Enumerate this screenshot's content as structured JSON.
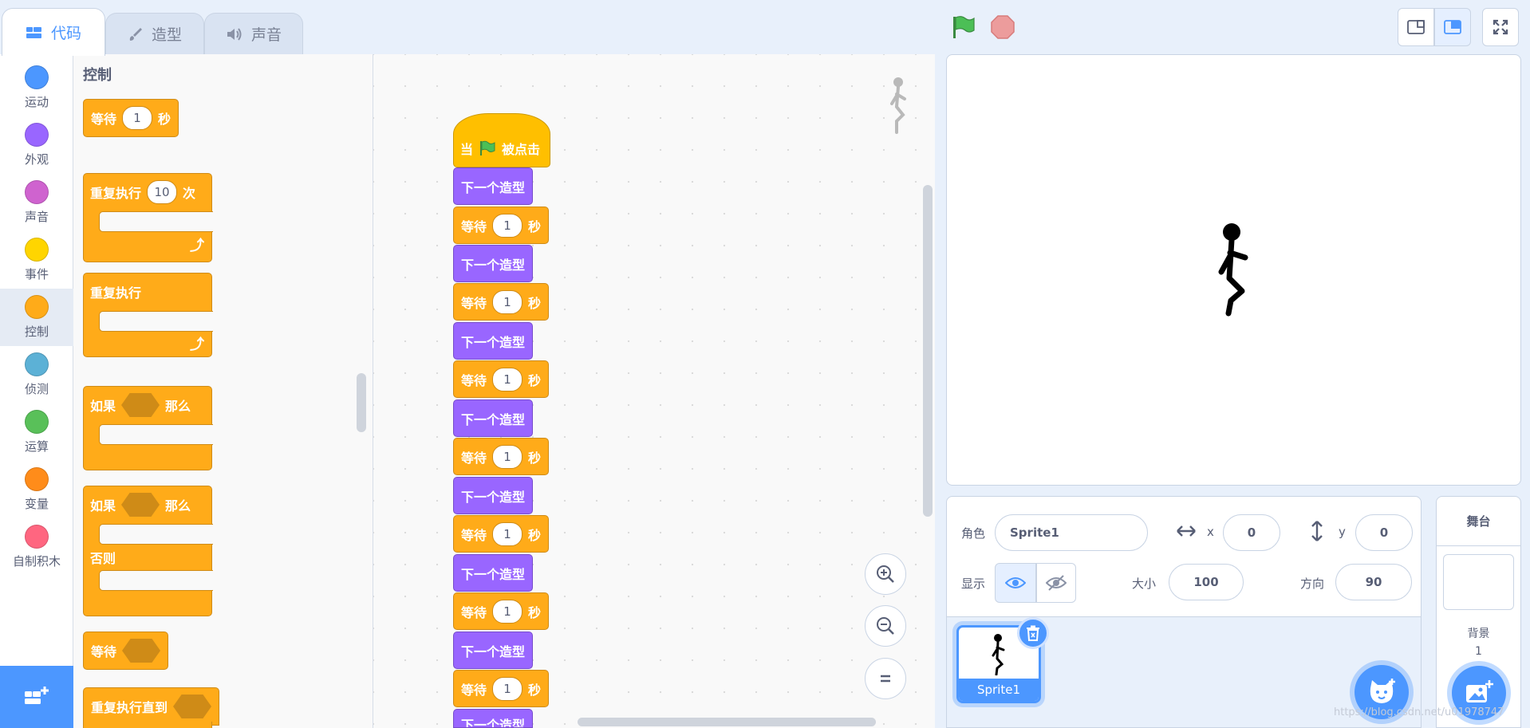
{
  "tabs": [
    {
      "label": "代码",
      "icon": "code-icon",
      "active": true
    },
    {
      "label": "造型",
      "icon": "brush-icon",
      "active": false
    },
    {
      "label": "声音",
      "icon": "speaker-icon",
      "active": false
    }
  ],
  "categories": [
    {
      "label": "运动",
      "color": "#4c97ff"
    },
    {
      "label": "外观",
      "color": "#9966ff"
    },
    {
      "label": "声音",
      "color": "#cf63cf"
    },
    {
      "label": "事件",
      "color": "#ffd500"
    },
    {
      "label": "控制",
      "color": "#ffab19",
      "selected": true
    },
    {
      "label": "侦测",
      "color": "#5cb1d6"
    },
    {
      "label": "运算",
      "color": "#59c059"
    },
    {
      "label": "变量",
      "color": "#ff8c1a"
    },
    {
      "label": "自制积木",
      "color": "#ff6680"
    }
  ],
  "palette": {
    "title": "控制",
    "wait": {
      "text": "等待",
      "value": "1",
      "unit": "秒"
    },
    "repeat": {
      "text": "重复执行",
      "value": "10",
      "unit": "次"
    },
    "forever": {
      "text": "重复执行"
    },
    "if_then": {
      "if": "如果",
      "then": "那么"
    },
    "if_else": {
      "if": "如果",
      "then": "那么",
      "else": "否则"
    },
    "wait_until": {
      "text": "等待"
    },
    "repeat_until": {
      "text": "重复执行直到"
    }
  },
  "script": {
    "hat": {
      "pre": "当",
      "post": "被点击"
    },
    "next_costume": "下一个造型",
    "wait": "等待",
    "wait_value": "1",
    "wait_unit": "秒"
  },
  "sprite_info": {
    "sprite_label": "角色",
    "sprite_name": "Sprite1",
    "x_label": "x",
    "x": "0",
    "y_label": "y",
    "y": "0",
    "show_label": "显示",
    "size_label": "大小",
    "size": "100",
    "direction_label": "方向",
    "direction": "90"
  },
  "sprite_list": {
    "sprites": [
      {
        "name": "Sprite1",
        "selected": true
      }
    ]
  },
  "stage_panel": {
    "title": "舞台",
    "backdrop_label": "背景",
    "backdrop_count": "1"
  },
  "watermark": "https://blog.csdn.net/u01978747",
  "colors": {
    "accent": "#4c97ff",
    "control": "#ffab19",
    "looks": "#9966ff",
    "events": "#ffbf00",
    "green_flag": "#4cbf56",
    "stop": "#ec9c9c"
  }
}
